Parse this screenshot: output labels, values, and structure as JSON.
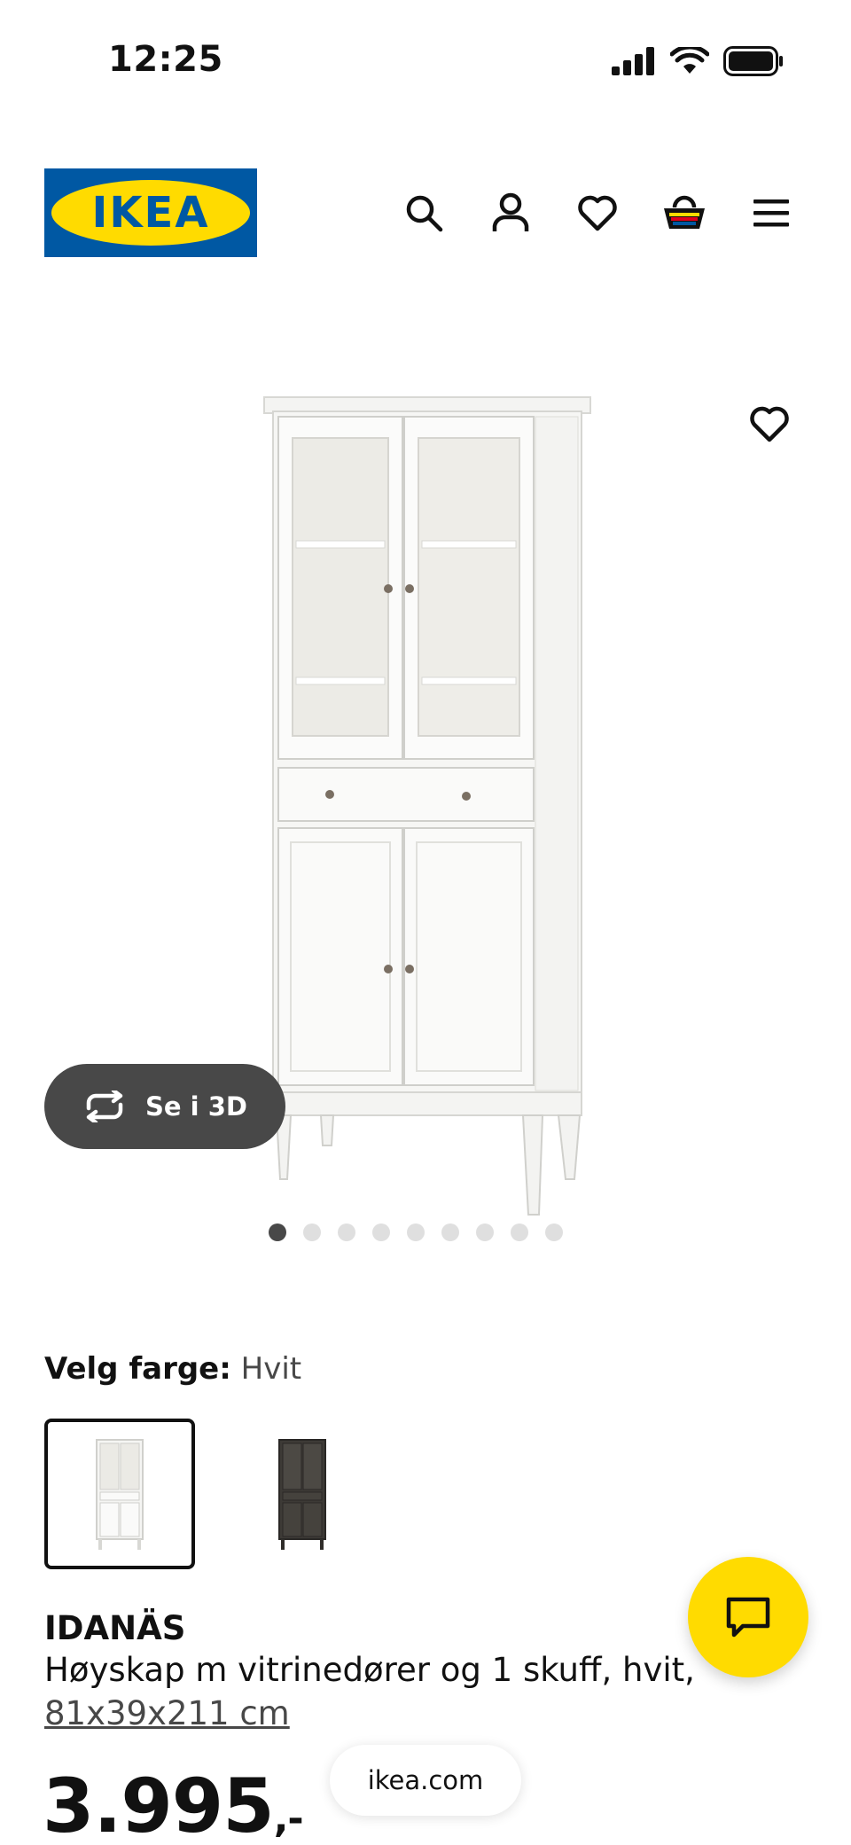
{
  "status_bar": {
    "time": "12:25"
  },
  "header": {
    "logo_text": "IKEA",
    "nav": [
      "search-icon",
      "account-icon",
      "favourites-icon",
      "basket-icon",
      "menu-icon"
    ]
  },
  "gallery": {
    "see_3d_label": "Se i 3D",
    "image_count": 9,
    "active_image": 1
  },
  "color_select": {
    "label": "Velg farge:",
    "value": "Hvit",
    "options": [
      "Hvit",
      "Mørk brun"
    ],
    "selected_index": 0
  },
  "product": {
    "name": "IDANÄS",
    "description": "Høyskap m vitrinedører og 1 skuff, hvit,",
    "size": "81x39x211 cm",
    "price": "3.995",
    "price_suffix": ",-"
  },
  "browser": {
    "url": "ikea.com"
  },
  "colors": {
    "ikea_blue": "#0058a3",
    "ikea_yellow": "#ffdb00",
    "pill_dark": "#484848"
  }
}
